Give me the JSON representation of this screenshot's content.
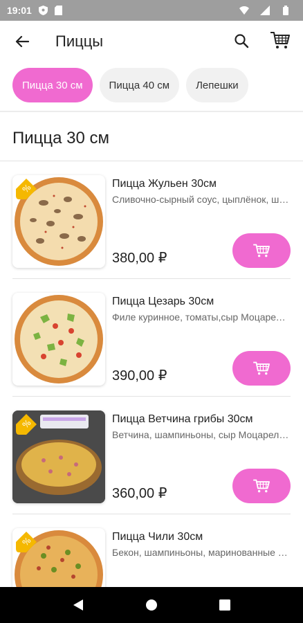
{
  "status_bar": {
    "time": "19:01",
    "icons": [
      "shield-icon",
      "sd-card-icon",
      "wifi-icon",
      "signal-icon",
      "battery-icon"
    ]
  },
  "app_bar": {
    "title": "Пиццы",
    "icons": [
      "back-arrow-icon",
      "search-icon",
      "cart-icon"
    ]
  },
  "categories": [
    {
      "label": "Пицца 30 см",
      "active": true
    },
    {
      "label": "Пицца 40 см",
      "active": false
    },
    {
      "label": "Лепешки",
      "active": false
    }
  ],
  "section": {
    "title": "Пицца 30 см"
  },
  "products": [
    {
      "name": "Пицца Жульен 30см",
      "description": "Сливочно-сырный соус, цыплёнок, шампиньоны, сыр Моцарелла",
      "price": "380,00 ₽",
      "badge": "discount-tag-icon"
    },
    {
      "name": "Пицца Цезарь 30см",
      "description": "Филе куринное, томаты,сыр Моцарелла, салат",
      "price": "390,00 ₽",
      "badge": ""
    },
    {
      "name": "Пицца Ветчина грибы 30см",
      "description": "Ветчина, шампиньоны, сыр Моцарелла, соус",
      "price": "360,00 ₽",
      "badge": "discount-tag-icon"
    },
    {
      "name": "Пицца Чили 30см",
      "description": "Бекон, шампиньоны, маринованные огурцы",
      "price": "",
      "badge": "discount-tag-icon"
    }
  ],
  "colors": {
    "accent": "#f06ad0",
    "badge": "#f5b800"
  },
  "nav_bar": {
    "icons": [
      "nav-back-icon",
      "nav-home-icon",
      "nav-recents-icon"
    ]
  }
}
